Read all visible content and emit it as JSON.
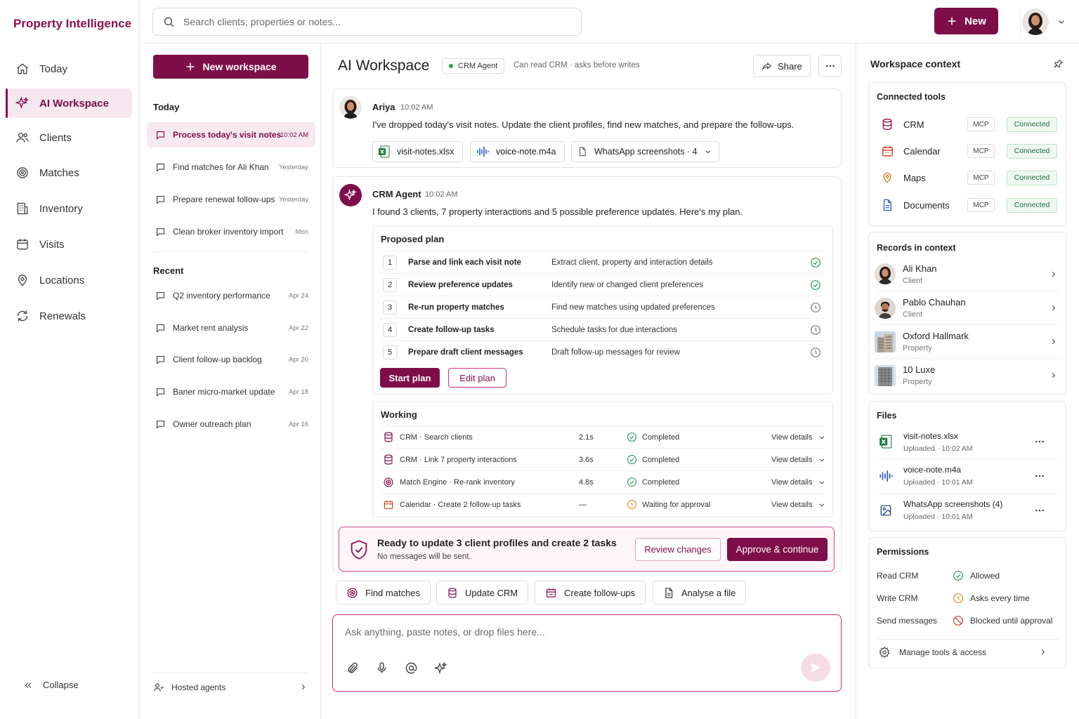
{
  "app": {
    "brand": "Property Intelligence"
  },
  "colors": {
    "brand": "#7e0e4a",
    "success": "#2e9a5a",
    "warning": "#e08a1c",
    "danger": "#d03a3a"
  },
  "nav": {
    "items": [
      {
        "label": "Today",
        "icon": "home-icon"
      },
      {
        "label": "AI Workspace",
        "icon": "sparkle-icon",
        "active": true
      },
      {
        "label": "Clients",
        "icon": "users-icon"
      },
      {
        "label": "Matches",
        "icon": "target-icon"
      },
      {
        "label": "Inventory",
        "icon": "building-icon"
      },
      {
        "label": "Visits",
        "icon": "calendar-icon"
      },
      {
        "label": "Locations",
        "icon": "map-pin-icon"
      },
      {
        "label": "Renewals",
        "icon": "refresh-icon"
      }
    ],
    "collapse_label": "Collapse"
  },
  "topbar": {
    "search_placeholder": "Search clients, properties or notes...",
    "new_label": "New"
  },
  "conversations": {
    "new_workspace_label": "New workspace",
    "today_header": "Today",
    "today": [
      {
        "title": "Process today's visit notes",
        "time": "10:02 AM"
      },
      {
        "title": "Find matches for Ali Khan",
        "time": "Yesterday"
      },
      {
        "title": "Prepare renewal follow-ups",
        "time": "Yesterday"
      },
      {
        "title": "Clean broker inventory import",
        "time": "Mon"
      }
    ],
    "recent_header": "Recent",
    "recent": [
      {
        "title": "Q2 inventory performance",
        "time": "Apr 24"
      },
      {
        "title": "Market rent analysis",
        "time": "Apr 22"
      },
      {
        "title": "Client follow-up backlog",
        "time": "Apr 20"
      },
      {
        "title": "Baner micro-market update",
        "time": "Apr 18"
      },
      {
        "title": "Owner outreach plan",
        "time": "Apr 16"
      }
    ],
    "hosted_agents_label": "Hosted agents"
  },
  "workspace": {
    "title": "AI Workspace",
    "agent_badge": "CRM Agent",
    "permission_note": "Can read CRM · asks before writes",
    "share_label": "Share"
  },
  "user_message": {
    "author": "Ariya",
    "time": "10:02 AM",
    "text": "I've dropped today's visit notes. Update the client profiles, find new matches, and prepare the follow-ups.",
    "attachments": [
      "visit-notes.xlsx",
      "voice-note.m4a",
      "WhatsApp screenshots · 4"
    ]
  },
  "agent_message": {
    "author": "CRM Agent",
    "time": "10:02 AM",
    "text": "I found 3 clients, 7 property interactions and 5 possible preference updates. Here's my plan."
  },
  "plan": {
    "header": "Proposed plan",
    "steps": [
      {
        "num": "1",
        "title": "Parse and link each visit note",
        "desc": "Extract client, property and interaction details",
        "status": "done"
      },
      {
        "num": "2",
        "title": "Review preference updates",
        "desc": "Identify new or changed client preferences",
        "status": "done"
      },
      {
        "num": "3",
        "title": "Re-run property matches",
        "desc": "Find new matches using updated preferences",
        "status": "pending"
      },
      {
        "num": "4",
        "title": "Create follow-up tasks",
        "desc": "Schedule tasks for due interactions",
        "status": "pending"
      },
      {
        "num": "5",
        "title": "Prepare draft client messages",
        "desc": "Draft follow-up messages for review",
        "status": "pending"
      }
    ],
    "start_label": "Start plan",
    "edit_label": "Edit plan"
  },
  "working": {
    "header": "Working",
    "view_details_label": "View details",
    "rows": [
      {
        "name": "CRM · Search clients",
        "duration": "2.1s",
        "status": "Completed",
        "icon": "database-icon"
      },
      {
        "name": "CRM · Link 7 property interactions",
        "duration": "3.6s",
        "status": "Completed",
        "icon": "database-icon"
      },
      {
        "name": "Match Engine · Re-rank inventory",
        "duration": "4.8s",
        "status": "Completed",
        "icon": "target-icon"
      },
      {
        "name": "Calendar · Create 2 follow-up tasks",
        "duration": "—",
        "status": "Waiting for approval",
        "icon": "calendar-icon"
      }
    ]
  },
  "approval": {
    "title": "Ready to update 3 client profiles and create 2 tasks",
    "subtitle": "No messages will be sent.",
    "review_label": "Review changes",
    "approve_label": "Approve & continue"
  },
  "quick_actions": [
    "Find matches",
    "Update CRM",
    "Create follow-ups",
    "Analyse a file"
  ],
  "composer": {
    "placeholder": "Ask anything, paste notes, or drop files here..."
  },
  "context": {
    "title": "Workspace context",
    "tools_header": "Connected tools",
    "tools": [
      {
        "name": "CRM",
        "type": "MCP",
        "status": "Connected",
        "icon": "database-icon"
      },
      {
        "name": "Calendar",
        "type": "MCP",
        "status": "Connected",
        "icon": "calendar-icon"
      },
      {
        "name": "Maps",
        "type": "MCP",
        "status": "Connected",
        "icon": "map-pin-icon"
      },
      {
        "name": "Documents",
        "type": "MCP",
        "status": "Connected",
        "icon": "document-icon"
      }
    ],
    "records_header": "Records in context",
    "records": [
      {
        "name": "Ali Khan",
        "type": "Client"
      },
      {
        "name": "Pablo Chauhan",
        "type": "Client"
      },
      {
        "name": "Oxford Hallmark",
        "type": "Property"
      },
      {
        "name": "10 Luxe",
        "type": "Property"
      }
    ],
    "files_header": "Files",
    "files": [
      {
        "name": "visit-notes.xlsx",
        "meta": "Uploaded · 10:02 AM"
      },
      {
        "name": "voice-note.m4a",
        "meta": "Uploaded · 10:01 AM"
      },
      {
        "name": "WhatsApp screenshots (4)",
        "meta": "Uploaded · 10:01 AM"
      }
    ],
    "permissions_header": "Permissions",
    "permissions": [
      {
        "key": "Read CRM",
        "value": "Allowed",
        "level": "allowed"
      },
      {
        "key": "Write CRM",
        "value": "Asks every time",
        "level": "ask"
      },
      {
        "key": "Send messages",
        "value": "Blocked until approval",
        "level": "blocked"
      }
    ],
    "manage_label": "Manage tools & access"
  }
}
